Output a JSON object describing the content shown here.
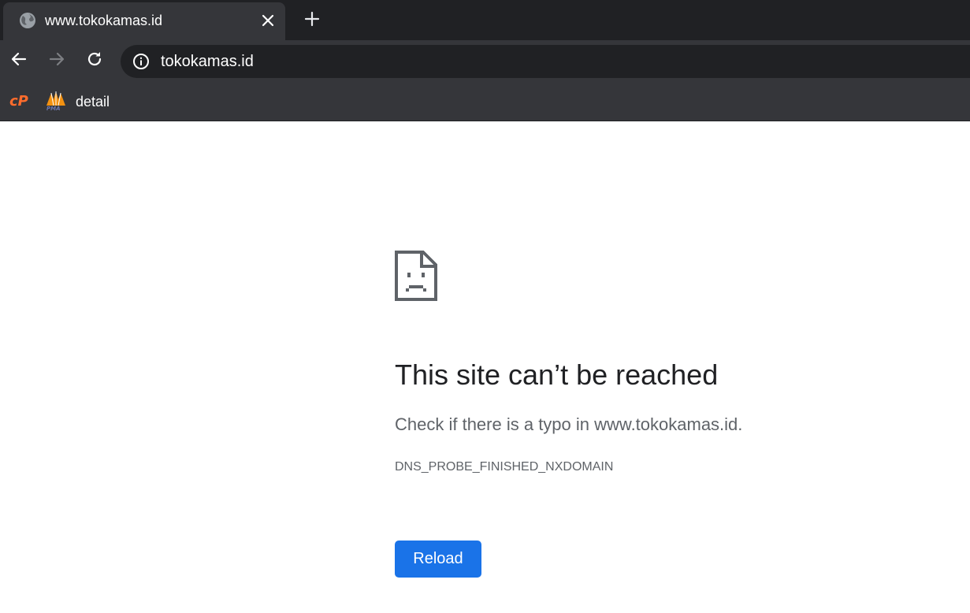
{
  "browser": {
    "tab": {
      "title": "www.tokokamas.id",
      "favicon": "globe-icon",
      "close_icon": "close-icon"
    },
    "new_tab_icon": "plus-icon",
    "toolbar": {
      "back_icon": "arrow-left-icon",
      "forward_icon": "arrow-right-icon",
      "reload_icon": "reload-icon",
      "address": "tokokamas.id",
      "site_info_icon": "info-circle-icon"
    },
    "bookmarks": [
      {
        "label": "cP",
        "icon": "cpanel-icon"
      },
      {
        "label": "detail",
        "icon": "phpmyadmin-icon",
        "icon_text": "PMA"
      }
    ]
  },
  "error_page": {
    "icon": "sad-page-icon",
    "title": "This site can’t be reached",
    "message": "Check if there is a typo in www.tokokamas.id.",
    "error_code": "DNS_PROBE_FINISHED_NXDOMAIN",
    "reload_label": "Reload"
  },
  "colors": {
    "tabstrip_bg": "#202124",
    "toolbar_bg": "#35363a",
    "omnibox_bg": "#202124",
    "reload_button": "#1a73e8",
    "cpanel_orange": "#ff6c2c",
    "title_text": "#202124",
    "secondary_text": "#5f6368"
  }
}
